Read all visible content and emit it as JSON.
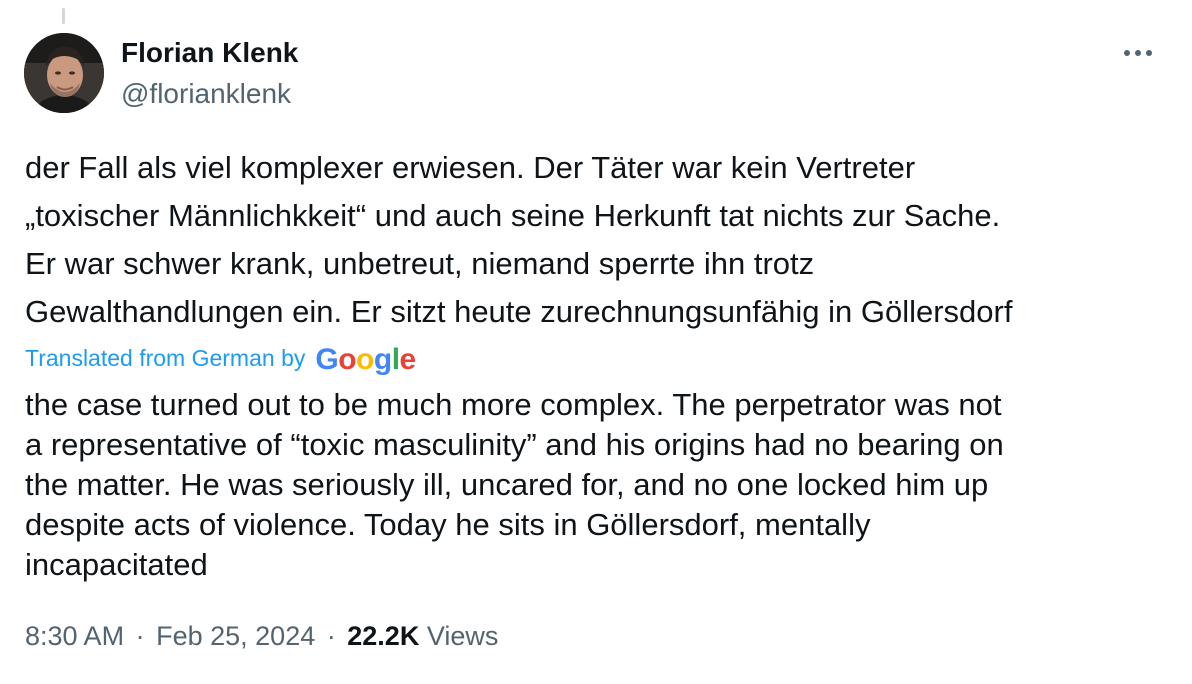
{
  "author": {
    "name": "Florian Klenk",
    "handle": "@florianklenk"
  },
  "more_icon": "more-horizontal-icon",
  "tweet": {
    "original_lines": [
      "der Fall als viel komplexer erwiesen. Der Täter war kein Vertreter",
      "„toxischer Männlichkkeit“ und auch seine Herkunft tat nichts zur Sache.",
      "Er war schwer krank, unbetreut, niemand sperrte ihn trotz",
      "Gewalthandlungen ein. Er sitzt heute zurechnungsunfähig in Göllersdorf"
    ],
    "translation_label": "Translated from German by",
    "translation_provider": "Google",
    "translated_lines": [
      "the case turned out to be much more complex. The perpetrator was not",
      "a representative of “toxic masculinity” and his origins had no bearing on",
      "the matter. He was seriously ill, uncared for, and no one locked him up",
      "despite acts of violence. Today he sits in Göllersdorf, mentally",
      "incapacitated"
    ]
  },
  "meta": {
    "time": "8:30 AM",
    "separator": "·",
    "date": "Feb 25, 2024",
    "views_count": "22.2K",
    "views_label": "Views"
  },
  "colors": {
    "link": "#1d9bf0",
    "secondary_text": "#536471",
    "primary_text": "#0f1419"
  }
}
